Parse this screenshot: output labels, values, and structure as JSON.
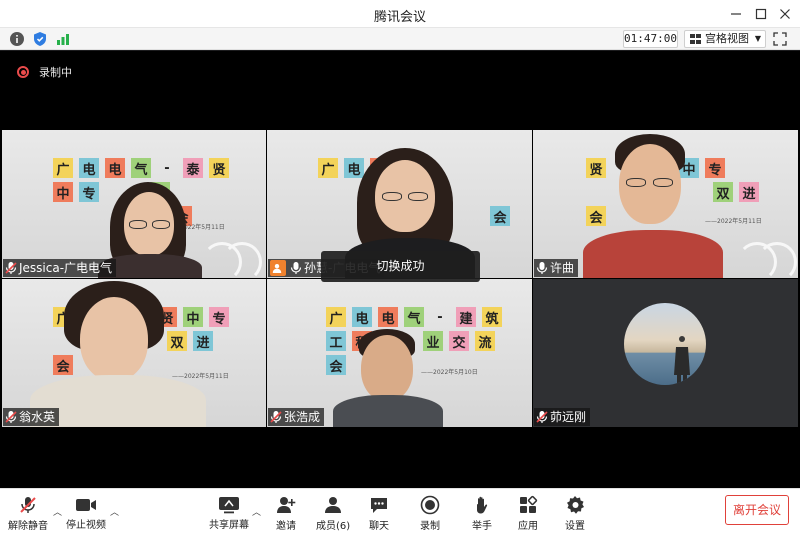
{
  "window": {
    "title": "腾讯会议"
  },
  "infobar": {
    "timer": "01:47:00",
    "view_label": "宫格视图"
  },
  "recording": {
    "label": "录制中"
  },
  "participants": [
    {
      "name": "Jessica-广电电气",
      "banner": [
        "广",
        "电",
        "电",
        "气",
        "-",
        "泰",
        "贤",
        "中",
        "专",
        "宣",
        "双",
        "进",
        "会"
      ],
      "date": "2022年5月11日"
    },
    {
      "name": "孙慧-广电电气",
      "banner": [
        "广",
        "电",
        "电",
        "气",
        "中",
        "专",
        "会"
      ],
      "date": ""
    },
    {
      "name": "许曲",
      "banner": [
        "贤",
        "中",
        "专",
        "双",
        "进",
        "会"
      ],
      "date": "——2022年5月11日"
    },
    {
      "name": "翁水英",
      "banner": [
        "广",
        "中",
        "贤",
        "中",
        "专",
        "双",
        "进",
        "会"
      ],
      "date": "——2022年5月11日"
    },
    {
      "name": "张浩成",
      "banner": [
        "广",
        "电",
        "电",
        "气",
        "-",
        "建",
        "筑",
        "工",
        "程",
        "业",
        "交",
        "流",
        "会"
      ],
      "date": "——2022年5月10日"
    },
    {
      "name": "茆远刚"
    }
  ],
  "toast": {
    "text": "切换成功"
  },
  "toolbar": {
    "unmute": "解除静音",
    "stop_video": "停止视频",
    "share_screen": "共享屏幕",
    "invite": "邀请",
    "members": "成员(6)",
    "chat": "聊天",
    "record": "录制",
    "raise_hand": "举手",
    "apps": "应用",
    "settings": "设置",
    "leave": "离开会议"
  },
  "colors": {
    "accent_green": "#26c26a",
    "leave_red": "#e0413a",
    "record_red": "#e94b4b"
  }
}
